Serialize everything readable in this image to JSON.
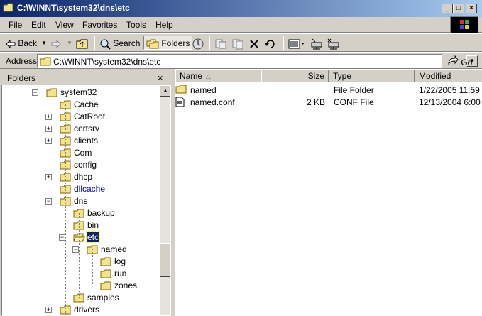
{
  "window": {
    "title": "C:\\WINNT\\system32\\dns\\etc",
    "minimize": "_",
    "maximize": "□",
    "close": "×"
  },
  "menu": [
    "File",
    "Edit",
    "View",
    "Favorites",
    "Tools",
    "Help"
  ],
  "toolbar": {
    "back_label": "Back",
    "search_label": "Search",
    "folders_label": "Folders"
  },
  "address": {
    "label": "Address",
    "value": "C:\\WINNT\\system32\\dns\\etc",
    "go_label": "Go"
  },
  "folders_pane": {
    "title": "Folders",
    "close": "×",
    "tree": [
      {
        "label": "system32",
        "exp": "-"
      },
      {
        "label": "Cache",
        "exp": ""
      },
      {
        "label": "CatRoot",
        "exp": "+"
      },
      {
        "label": "certsrv",
        "exp": "+"
      },
      {
        "label": "clients",
        "exp": "+"
      },
      {
        "label": "Com",
        "exp": ""
      },
      {
        "label": "config",
        "exp": ""
      },
      {
        "label": "dhcp",
        "exp": "+"
      },
      {
        "label": "dllcache",
        "exp": ""
      },
      {
        "label": "dns",
        "exp": "-"
      },
      {
        "label": "backup",
        "exp": ""
      },
      {
        "label": "bin",
        "exp": ""
      },
      {
        "label": "etc",
        "exp": "-"
      },
      {
        "label": "named",
        "exp": "-"
      },
      {
        "label": "log",
        "exp": ""
      },
      {
        "label": "run",
        "exp": ""
      },
      {
        "label": "zones",
        "exp": ""
      },
      {
        "label": "samples",
        "exp": ""
      },
      {
        "label": "drivers",
        "exp": "+"
      }
    ]
  },
  "columns": {
    "name": "Name",
    "size": "Size",
    "type": "Type",
    "modified": "Modified"
  },
  "files": [
    {
      "name": "named",
      "size": "",
      "type": "File Folder",
      "modified": "1/22/2005 11:59"
    },
    {
      "name": "named.conf",
      "size": "2 KB",
      "type": "CONF File",
      "modified": "12/13/2004 6:00"
    }
  ],
  "colors": {
    "title_start": "#0a246a",
    "title_end": "#a6caf0",
    "folder_fill": "#f5e38a",
    "selection": "#0a246a",
    "compressed_text": "#0000cc"
  }
}
